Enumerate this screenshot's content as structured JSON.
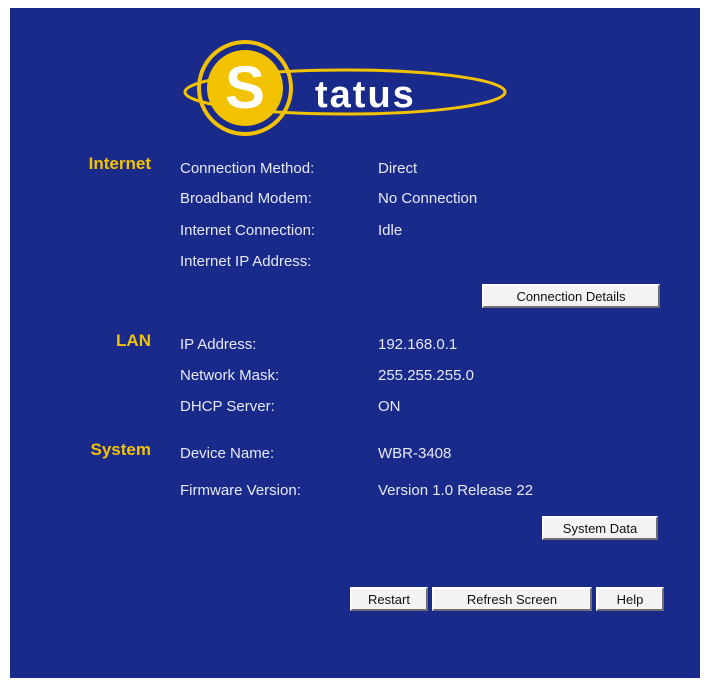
{
  "logo": {
    "letter": "S",
    "text": "tatus"
  },
  "sections": {
    "internet": "Internet",
    "lan": "LAN",
    "system": "System"
  },
  "internet": {
    "connection_method_label": "Connection Method:",
    "connection_method_value": "Direct",
    "broadband_modem_label": "Broadband Modem:",
    "broadband_modem_value": "No Connection",
    "internet_connection_label": "Internet Connection:",
    "internet_connection_value": "Idle",
    "internet_ip_label": "Internet IP Address:",
    "internet_ip_value": ""
  },
  "lan": {
    "ip_label": "IP Address:",
    "ip_value": "192.168.0.1",
    "mask_label": "Network Mask:",
    "mask_value": "255.255.255.0",
    "dhcp_label": "DHCP Server:",
    "dhcp_value": "ON"
  },
  "system": {
    "device_name_label": "Device Name:",
    "device_name_value": "WBR-3408",
    "firmware_label": "Firmware Version:",
    "firmware_value": "Version 1.0 Release 22"
  },
  "buttons": {
    "connection_details": "Connection Details",
    "system_data": "System Data",
    "restart": "Restart",
    "refresh_screen": "Refresh Screen",
    "help": "Help"
  },
  "colors": {
    "panel": "#1a2a8a",
    "accent": "#f2c200",
    "text": "#e6e9f5"
  }
}
